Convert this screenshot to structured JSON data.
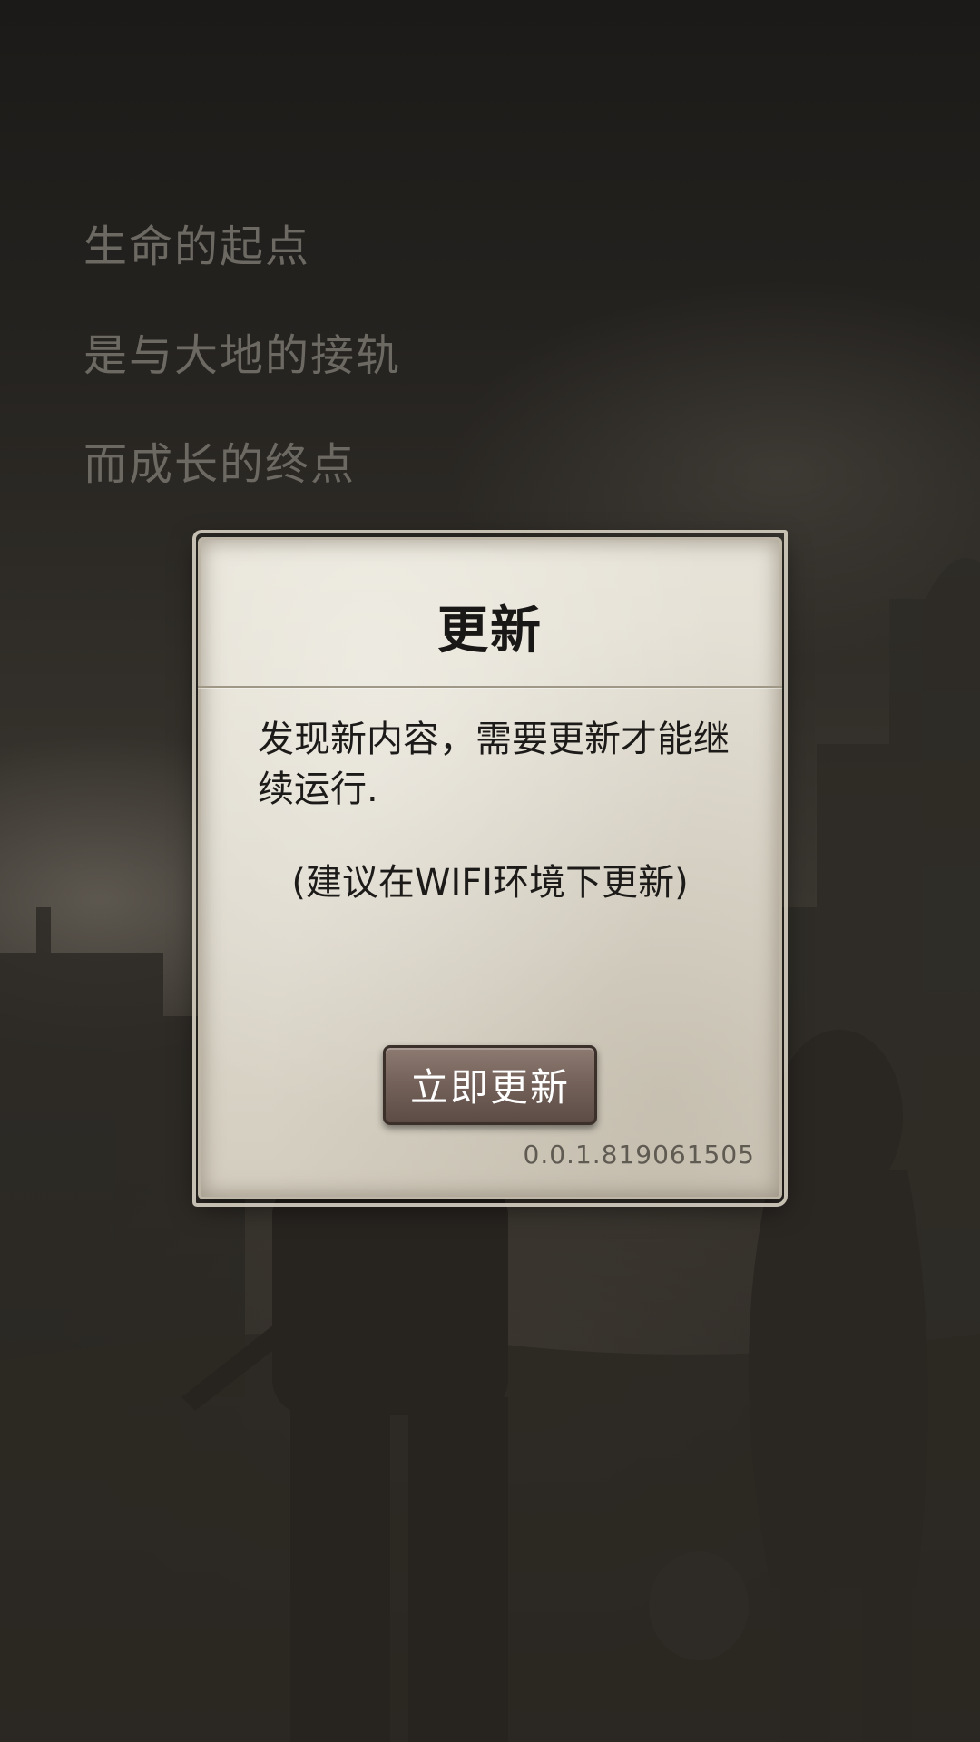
{
  "intro": {
    "line1": "生命的起点",
    "line2": "是与大地的接轨",
    "line3": "而成长的终点"
  },
  "dialog": {
    "title": "更新",
    "message": "发现新内容，需要更新才能继续运行.",
    "hint": "(建议在WIFI环境下更新)",
    "button_label": "立即更新",
    "version": "0.0.1.819061505"
  },
  "colors": {
    "intro_text": "#6c6963",
    "parchment": "#e2ddd1",
    "button": "#75635b"
  }
}
